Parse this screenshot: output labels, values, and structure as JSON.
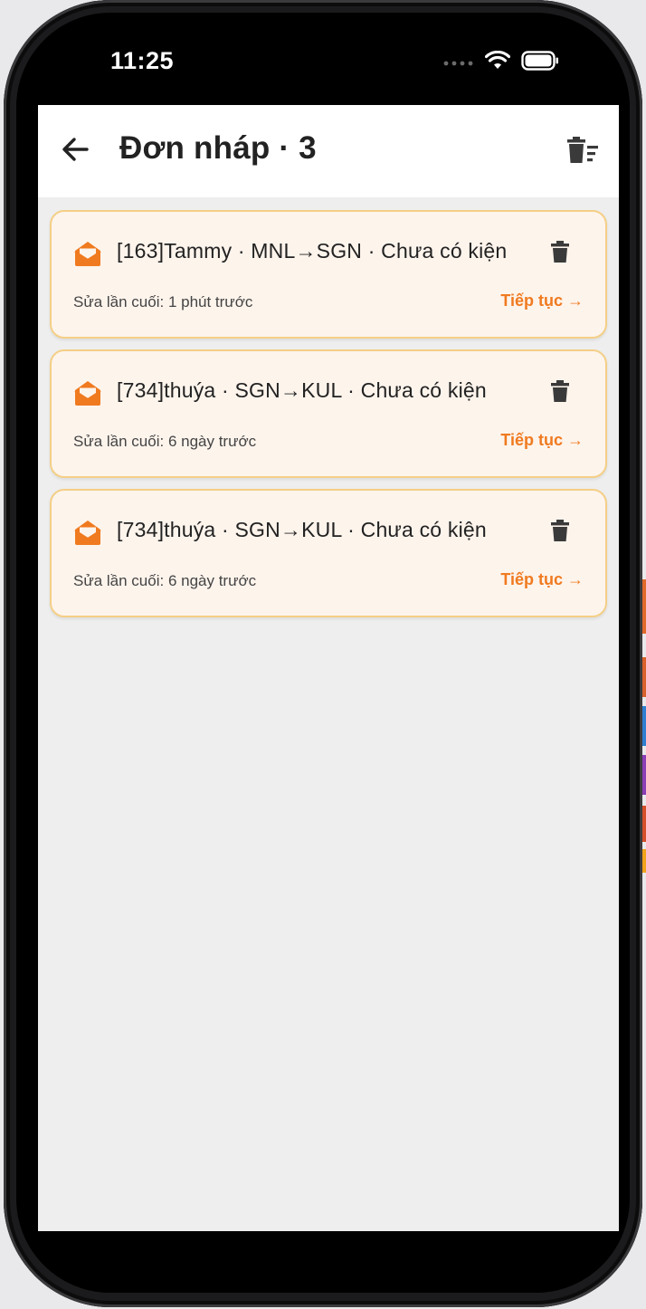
{
  "status_bar": {
    "time": "11:25"
  },
  "appbar": {
    "back_icon": "arrow-left-icon",
    "title": "Đơn nháp · 3",
    "clear_all_icon": "trash-sweep-icon"
  },
  "drafts": [
    {
      "title": "[163]Tammy · MNL→SGN · Chưa có kiện",
      "edited": "Sửa lần cuối: 1 phút trước",
      "continue_label": "Tiếp tục →"
    },
    {
      "title": "[734]thuýa · SGN→KUL · Chưa có kiện",
      "edited": "Sửa lần cuối: 6 ngày trước",
      "continue_label": "Tiếp tục →"
    },
    {
      "title": "[734]thuýa · SGN→KUL · Chưa có kiện",
      "edited": "Sửa lần cuối: 6 ngày trước",
      "continue_label": "Tiếp tục →"
    }
  ],
  "colors": {
    "accent": "#f07a1f",
    "card_bg": "#fdf4ec",
    "card_border": "#f4cf86",
    "screen_bg": "#eeeeee"
  }
}
